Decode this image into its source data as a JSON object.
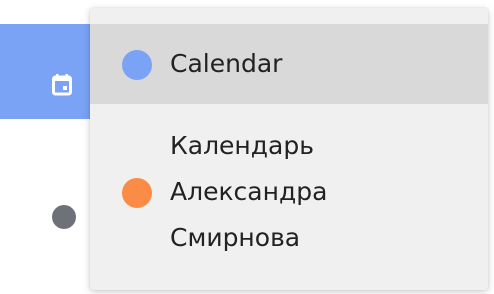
{
  "colors": {
    "rail_selected": "#7aa2f5",
    "rail_dot": "#6e7278",
    "menu_bg": "#f0f0f0",
    "menu_hover": "#d9d9d9",
    "calendar_1": "#7aa2f5",
    "calendar_2": "#fb8c45"
  },
  "rail": {
    "selected_icon": "calendar-icon"
  },
  "menu": {
    "items": [
      {
        "label": "Calendar",
        "color": "#7aa2f5"
      },
      {
        "label": "Календарь Александра Смирнова",
        "color": "#fb8c45"
      }
    ]
  }
}
